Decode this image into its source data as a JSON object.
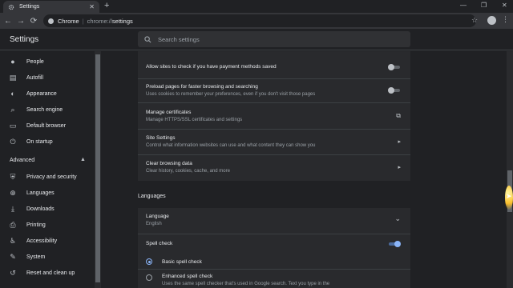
{
  "browser": {
    "tab_title": "Settings",
    "tab_close": "✕",
    "new_tab": "+",
    "window_controls": [
      "—",
      "❐",
      "✕"
    ],
    "back": "←",
    "forward": "→",
    "reload": "⟳",
    "omnibox": {
      "site_label": "Chrome",
      "separator": "|",
      "url_prefix": "chrome://",
      "url_path": "settings"
    },
    "star": "☆",
    "menu": "⋮"
  },
  "header": {
    "title": "Settings",
    "search_placeholder": "Search settings"
  },
  "sidebar": {
    "items": [
      {
        "label": "People",
        "icon": "person-icon",
        "glyph": "●"
      },
      {
        "label": "Autofill",
        "icon": "clipboard-icon",
        "glyph": "▤"
      },
      {
        "label": "Appearance",
        "icon": "palette-icon",
        "glyph": "◐"
      },
      {
        "label": "Search engine",
        "icon": "search-icon",
        "glyph": "⌕"
      },
      {
        "label": "Default browser",
        "icon": "browser-icon",
        "glyph": "▭"
      },
      {
        "label": "On startup",
        "icon": "power-icon",
        "glyph": "⏻"
      }
    ],
    "advanced_label": "Advanced",
    "advanced_arrow": "▲",
    "advanced_items": [
      {
        "label": "Privacy and security",
        "icon": "shield-icon",
        "glyph": "⛨"
      },
      {
        "label": "Languages",
        "icon": "globe-icon",
        "glyph": "⊕"
      },
      {
        "label": "Downloads",
        "icon": "download-icon",
        "glyph": "⤓"
      },
      {
        "label": "Printing",
        "icon": "printer-icon",
        "glyph": "⎙"
      },
      {
        "label": "Accessibility",
        "icon": "accessibility-icon",
        "glyph": "♿"
      },
      {
        "label": "System",
        "icon": "wrench-icon",
        "glyph": "✎"
      },
      {
        "label": "Reset and clean up",
        "icon": "history-icon",
        "glyph": "↺"
      }
    ]
  },
  "privacy": {
    "payment_methods": {
      "label": "Allow sites to check if you have payment methods saved",
      "enabled": false
    },
    "preload": {
      "label": "Preload pages for faster browsing and searching",
      "sub": "Uses cookies to remember your preferences, even if you don't visit those pages",
      "enabled": false
    },
    "certificates": {
      "label": "Manage certificates",
      "sub": "Manage HTTPS/SSL certificates and settings",
      "icon": "external-link-icon",
      "glyph": "⧉"
    },
    "site_settings": {
      "label": "Site Settings",
      "sub": "Control what information websites can use and what content they can show you",
      "glyph": "▸"
    },
    "clear_data": {
      "label": "Clear browsing data",
      "sub": "Clear history, cookies, cache, and more",
      "glyph": "▸"
    }
  },
  "languages": {
    "section_title": "Languages",
    "language": {
      "label": "Language",
      "value": "English",
      "glyph": "⌄"
    },
    "spell_check": {
      "label": "Spell check",
      "enabled": true
    },
    "basic": {
      "label": "Basic spell check",
      "selected": true
    },
    "enhanced": {
      "label": "Enhanced spell check",
      "sub": "Uses the same spell checker that's used in Google search. Text you type in the",
      "selected": false
    }
  },
  "colors": {
    "accent": "#8ab4f8",
    "background": "#202124",
    "card": "#292a2d"
  }
}
